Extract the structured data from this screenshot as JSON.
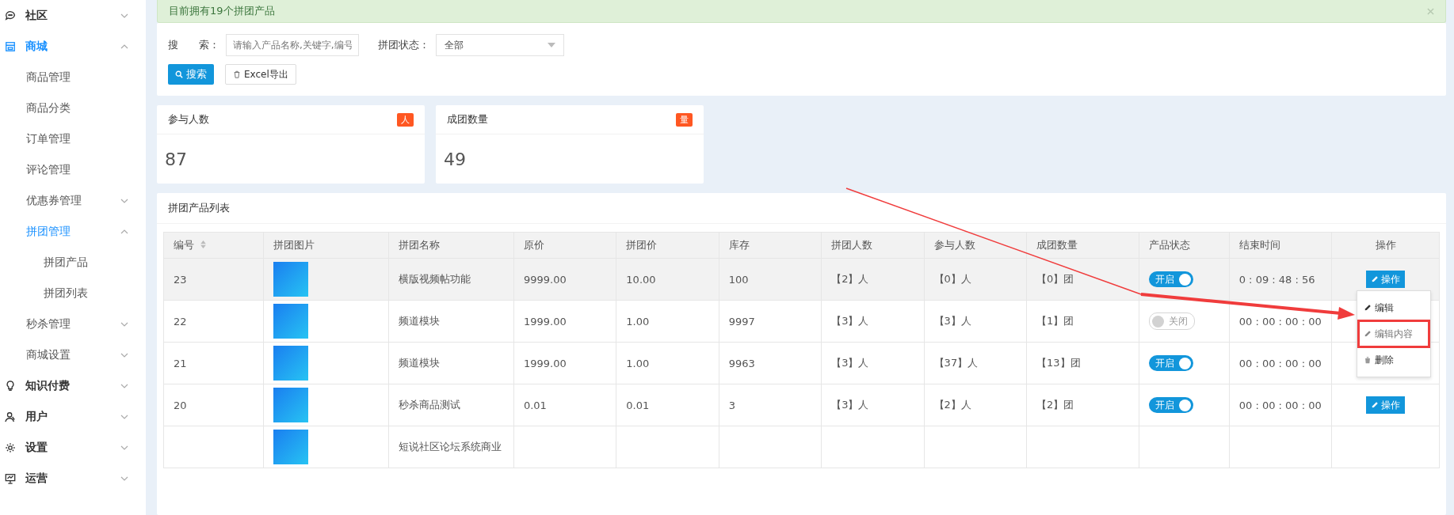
{
  "sidebar": {
    "items": [
      {
        "label": "社区",
        "expanded": false,
        "selected": false
      },
      {
        "label": "商城",
        "expanded": true,
        "selected": true,
        "children": [
          {
            "label": "商品管理",
            "selected": false
          },
          {
            "label": "商品分类",
            "selected": false
          },
          {
            "label": "订单管理",
            "selected": false
          },
          {
            "label": "评论管理",
            "selected": false
          },
          {
            "label": "优惠券管理",
            "expanded": false,
            "selected": false
          },
          {
            "label": "拼团管理",
            "expanded": true,
            "selected": true,
            "children": [
              {
                "label": "拼团产品",
                "selected": false
              },
              {
                "label": "拼团列表",
                "selected": false
              }
            ]
          },
          {
            "label": "秒杀管理",
            "expanded": false,
            "selected": false
          },
          {
            "label": "商城设置",
            "expanded": false,
            "selected": false
          }
        ]
      },
      {
        "label": "知识付费",
        "expanded": false,
        "selected": false
      },
      {
        "label": "用户",
        "expanded": false,
        "selected": false
      },
      {
        "label": "设置",
        "expanded": false,
        "selected": false
      },
      {
        "label": "运营",
        "expanded": false,
        "selected": false
      }
    ]
  },
  "alert": {
    "text": "目前拥有19个拼团产品"
  },
  "search": {
    "label": "搜　　索：",
    "placeholder": "请输入产品名称,关键字,编号",
    "status_label": "拼团状态：",
    "status_value": "全部",
    "buttons": [
      {
        "kind": "search",
        "label": "搜索"
      },
      {
        "kind": "export",
        "label": "Excel导出"
      }
    ]
  },
  "stats": [
    {
      "label": "参与人数",
      "badge": "人",
      "value": "87"
    },
    {
      "label": "成团数量",
      "badge": "量",
      "value": "49"
    }
  ],
  "table": {
    "title": "拼团产品列表",
    "columns": [
      "编号",
      "拼团图片",
      "拼团名称",
      "原价",
      "拼团价",
      "库存",
      "拼团人数",
      "参与人数",
      "成团数量",
      "产品状态",
      "结束时间",
      "操作"
    ],
    "rows": [
      {
        "selected": true,
        "id": "23",
        "name": "横版视频帖功能",
        "price": "9999.00",
        "group_price": "10.00",
        "stock": "100",
        "group_size": "【2】人",
        "participants": "【0】人",
        "groups": "【0】团",
        "status": {
          "on": true,
          "label": "开启"
        },
        "end_time": "0 : 09 : 48 : 56",
        "action": "操作"
      },
      {
        "selected": false,
        "id": "22",
        "name": "频道模块",
        "price": "1999.00",
        "group_price": "1.00",
        "stock": "9997",
        "group_size": "【3】人",
        "participants": "【3】人",
        "groups": "【1】团",
        "status": {
          "on": false,
          "label": "关闭"
        },
        "end_time": "00 : 00 : 00 : 00"
      },
      {
        "selected": false,
        "id": "21",
        "name": "频道模块",
        "price": "1999.00",
        "group_price": "1.00",
        "stock": "9963",
        "group_size": "【3】人",
        "participants": "【37】人",
        "groups": "【13】团",
        "status": {
          "on": true,
          "label": "开启"
        },
        "end_time": "00 : 00 : 00 : 00"
      },
      {
        "selected": false,
        "id": "20",
        "name": "秒杀商品测试",
        "price": "0.01",
        "group_price": "0.01",
        "stock": "3",
        "group_size": "【3】人",
        "participants": "【2】人",
        "groups": "【2】团",
        "status": {
          "on": true,
          "label": "开启"
        },
        "end_time": "00 : 00 : 00 : 00",
        "action": "操作"
      },
      {
        "selected": false,
        "name": "短说社区论坛系统商业"
      }
    ]
  },
  "action_menu": {
    "items": [
      {
        "kind": "edit",
        "label": "编辑",
        "highlighted": false
      },
      {
        "kind": "edit",
        "label": "编辑内容",
        "highlighted": true
      },
      {
        "kind": "delete",
        "label": "删除",
        "highlighted": false
      }
    ]
  },
  "annotations": [
    {
      "kind": "arrow"
    }
  ]
}
